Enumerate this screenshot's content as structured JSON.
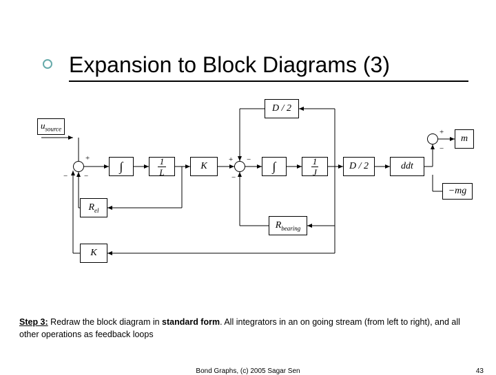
{
  "title": "Expansion to Block Diagrams (3)",
  "caption": {
    "lead": "Step 3:",
    "body_a": " Redraw the block diagram in ",
    "bold": "standard form",
    "body_b": ". All integrators in an on going stream (from left to right), and all other operations as feedback loops"
  },
  "footer": {
    "center": "Bond Graphs, (c) 2005 Sagar Sen",
    "page": "43"
  },
  "diagram": {
    "source": "u",
    "source_sub": "source",
    "blocks": {
      "int1": "∫",
      "invL": {
        "n": "1",
        "d": "L"
      },
      "K_fwd": "K",
      "int2": "∫",
      "invJ": {
        "n": "1",
        "d": "J"
      },
      "Dhalf_a": "D / 2",
      "ddt": "ddt",
      "Dhalf_top": "D / 2",
      "Rel": "R",
      "Rel_sub": "el",
      "K_fb": "K",
      "Rbearing": "R",
      "Rbearing_sub": "bearing",
      "m": "m",
      "neg_mg": "−mg"
    },
    "signs": {
      "s1_top": "+",
      "s1_bot_l": "−",
      "s1_bot_r": "−",
      "s2_top": "+",
      "s2_bot_l": "−",
      "s2_right": "−",
      "s3_top": "+",
      "s3_bot": "−",
      "sm_top": "+",
      "sm_bot": "−"
    }
  }
}
